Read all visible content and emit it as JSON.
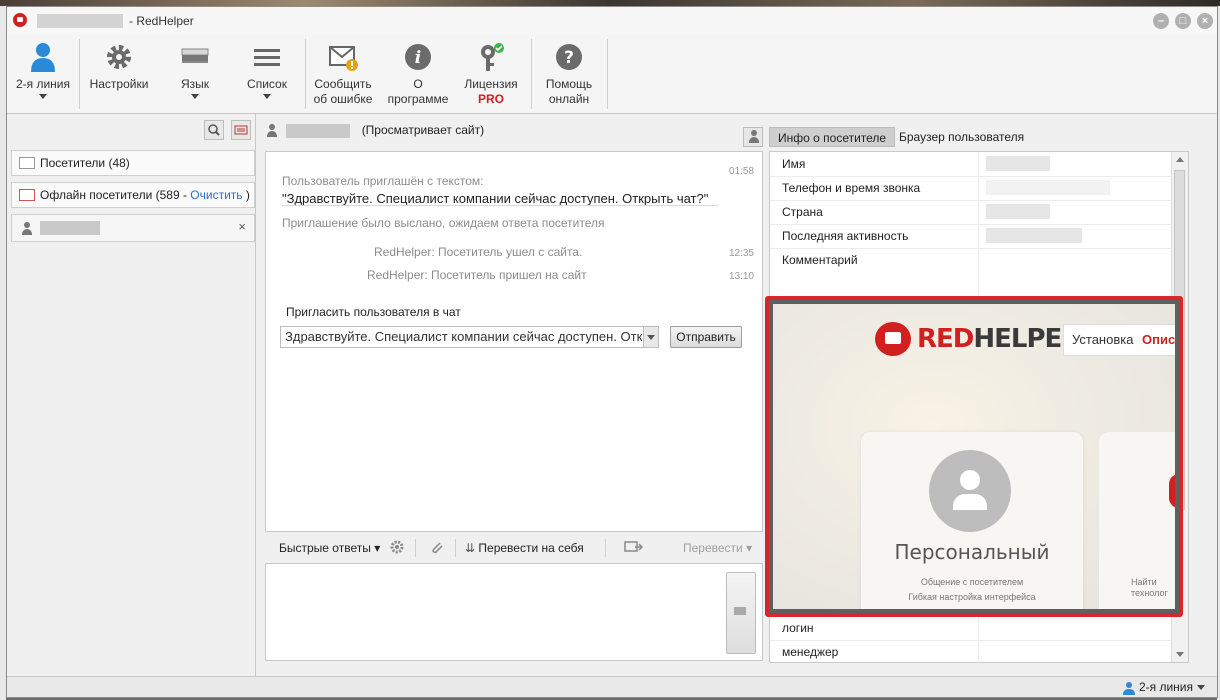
{
  "window": {
    "title_suffix": "- RedHelper",
    "controls": [
      "minimize-icon",
      "maximize-icon",
      "close-icon"
    ]
  },
  "toolbar": {
    "items": [
      {
        "label": "2-я линия",
        "icon": "user-icon"
      },
      {
        "label": "Настройки",
        "icon": "gear-icon"
      },
      {
        "label": "Язык",
        "icon": "flag-icon"
      },
      {
        "label": "Список",
        "icon": "list-icon"
      },
      {
        "label1": "Сообщить",
        "label2": "об ошибке",
        "icon": "mail-warning-icon"
      },
      {
        "label1": "О",
        "label2": "программе",
        "icon": "info-icon"
      },
      {
        "label1": "Лицензия",
        "label2": "PRO",
        "icon": "key-icon"
      },
      {
        "label1": "Помощь",
        "label2": "онлайн",
        "icon": "help-icon"
      }
    ]
  },
  "sidebar": {
    "visitors": "Посетители (48)",
    "offline_prefix": "Офлайн посетители (589 - ",
    "offline_clear": "Очистить",
    "offline_suffix": " )",
    "current_visitor_close": "×"
  },
  "chat": {
    "header_status": "(Просматривает сайт)",
    "invite_intro": "Пользователь приглашён с текстом:",
    "invite_text": "\"Здравствуйте. Специалист компании сейчас доступен. Открыть чат?\"",
    "invite_time": "01:58",
    "invite_sent": "Приглашение было выслано, ожидаем ответа посетителя",
    "events": [
      {
        "sender": "RedHelper:",
        "text": "Посетитель ушел с сайта.",
        "time": "12:35"
      },
      {
        "sender": "RedHelper:",
        "text": "Посетитель пришел на сайт",
        "time": "13:10"
      }
    ],
    "invite_label": "Пригласить пользователя в чат",
    "invite_input_value": "Здравствуйте. Специалист компании сейчас доступен. Открыть чат?",
    "send_button": "Отправить"
  },
  "reply_toolbar": {
    "quick_replies": "Быстрые ответы",
    "transfer_to_self": "Перевести на себя",
    "transfer": "Перевести"
  },
  "right_panel": {
    "tabs": [
      "Инфо о посетителе",
      "Браузер пользователя"
    ],
    "active_tab": 0,
    "rows": [
      {
        "key": "Имя"
      },
      {
        "key": "Телефон и время звонка"
      },
      {
        "key": "Страна"
      },
      {
        "key": "Последняя активность"
      },
      {
        "key": "Комментарий"
      },
      {
        "key": "логин"
      },
      {
        "key": "менеджер"
      }
    ],
    "preview": {
      "logo_red": "RED",
      "logo_gray": "HELPER",
      "nav_install": "Установка",
      "nav_desc": "Описа",
      "card_title": "Персональный",
      "card_sub": "Общение с посетителем",
      "card_sub2": "Гибкая настройка интерфейса",
      "card2_line1": "Найти",
      "card2_line2": "технолог"
    }
  },
  "status_bar": {
    "line": "2-я линия"
  },
  "colors": {
    "brand_red": "#d21f1f",
    "highlight_border": "#d8262a",
    "link": "#2a6fc9"
  }
}
